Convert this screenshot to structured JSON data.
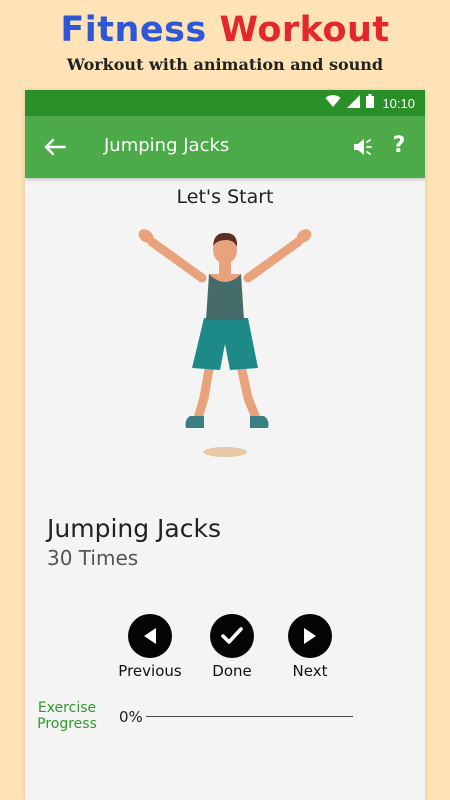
{
  "promo": {
    "title_word1": "Fitness",
    "title_word2": "Workout",
    "subtitle": "Workout with animation and sound"
  },
  "statusbar": {
    "time": "10:10"
  },
  "appbar": {
    "title": "Jumping Jacks",
    "back_icon": "arrow-left-icon",
    "sound_icon": "speaker-icon",
    "help_label": "?"
  },
  "stage": {
    "heading": "Let's Start"
  },
  "exercise": {
    "name": "Jumping Jacks",
    "reps": "30 Times"
  },
  "controls": {
    "previous_label": "Previous",
    "done_label": "Done",
    "next_label": "Next"
  },
  "progress": {
    "label": "Exercise Progress",
    "value_text": "0%",
    "value": 0
  },
  "colors": {
    "statusbar": "#2a8f28",
    "appbar": "#4cab48",
    "accent": "#2e9a2a",
    "background": "#fde3b5"
  }
}
